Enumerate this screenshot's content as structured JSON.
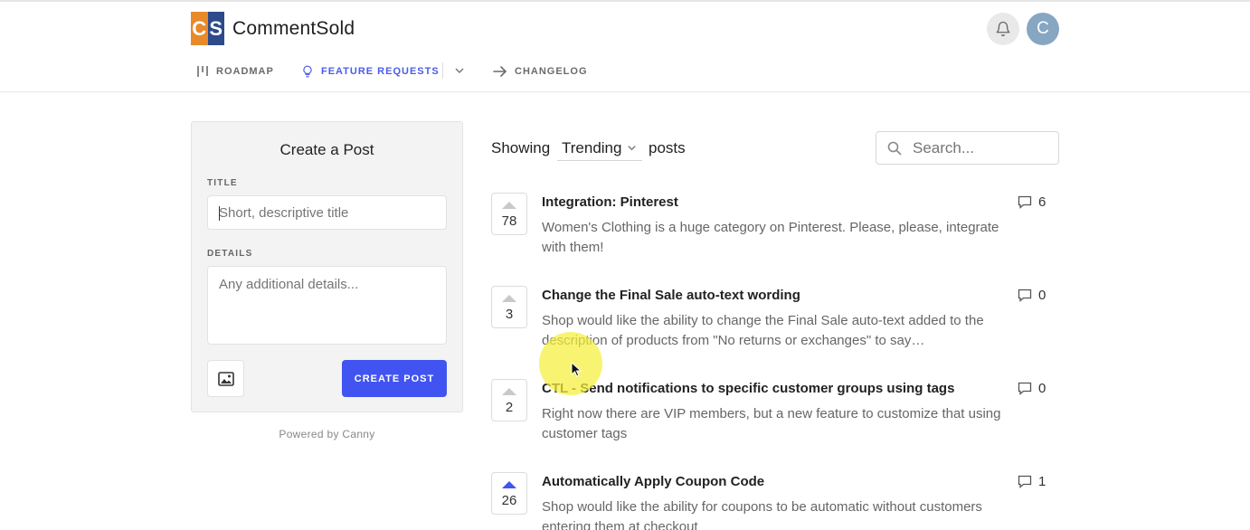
{
  "app": {
    "logo_c": "C",
    "logo_s": "S",
    "brand": "CommentSold",
    "avatar_initial": "C",
    "brand_colors": {
      "logo_orange": "#e88a2a",
      "logo_blue": "#2c4a8c",
      "accent": "#4154f1"
    }
  },
  "nav": {
    "roadmap": "ROADMAP",
    "feature_requests": "FEATURE REQUESTS",
    "changelog": "CHANGELOG",
    "icons": {
      "roadmap": "roadmap-icon",
      "feature_requests": "lightbulb-icon",
      "changelog": "arrow-right-icon",
      "dropdown": "chevron-down-icon"
    }
  },
  "create_post": {
    "heading": "Create a Post",
    "title_label": "TITLE",
    "title_placeholder": "Short, descriptive title",
    "details_label": "DETAILS",
    "details_placeholder": "Any additional details...",
    "submit_label": "CREATE POST",
    "powered_by": "Powered by Canny"
  },
  "list": {
    "showing_label": "Showing",
    "sort_value": "Trending",
    "posts_label": "posts",
    "search_placeholder": "Search..."
  },
  "posts": [
    {
      "title": "Integration: Pinterest",
      "description": "Women's Clothing is a huge category on Pinterest. Please, please, integrate with them!",
      "votes": "78",
      "comments": "6",
      "voted": false
    },
    {
      "title": "Change the Final Sale auto-text wording",
      "description": "Shop would like the ability to change the Final Sale auto-text added to the description of products from \"No returns or exchanges\" to say…",
      "votes": "3",
      "comments": "0",
      "voted": false
    },
    {
      "title": "CTL - Send notifications to specific customer groups using tags",
      "description": "Right now there are VIP members, but a new feature to customize that using customer tags",
      "votes": "2",
      "comments": "0",
      "voted": false
    },
    {
      "title": "Automatically Apply Coupon Code",
      "description": "Shop would like the ability for coupons to be automatic without customers entering them at checkout",
      "votes": "26",
      "comments": "1",
      "voted": true
    }
  ]
}
